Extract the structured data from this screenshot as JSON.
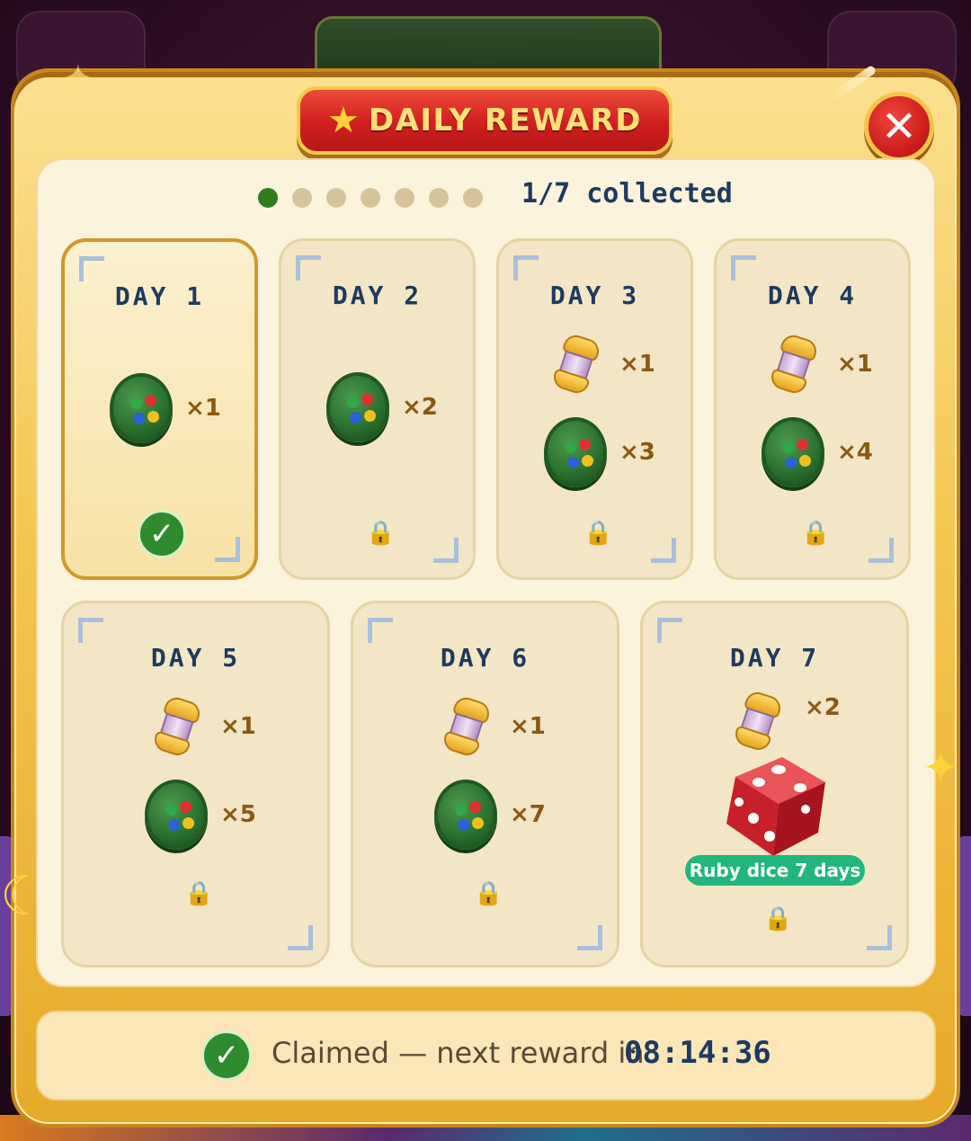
{
  "modal": {
    "title": "DAILY REWARD",
    "title_icon": "star-icon",
    "close_icon": "close-icon"
  },
  "progress": {
    "collected": 1,
    "total": 7,
    "label": "1/7 collected"
  },
  "days": [
    {
      "label": "DAY 1",
      "rewards": [
        {
          "item": "green-gem-token",
          "qty": "×1"
        }
      ],
      "status": "claimed"
    },
    {
      "label": "DAY 2",
      "rewards": [
        {
          "item": "green-gem-token",
          "qty": "×2"
        }
      ],
      "status": "locked"
    },
    {
      "label": "DAY 3",
      "rewards": [
        {
          "item": "gold-capsule",
          "qty": "×1"
        },
        {
          "item": "green-gem-token",
          "qty": "×3"
        }
      ],
      "status": "locked"
    },
    {
      "label": "DAY 4",
      "rewards": [
        {
          "item": "gold-capsule",
          "qty": "×1"
        },
        {
          "item": "green-gem-token",
          "qty": "×4"
        }
      ],
      "status": "locked"
    },
    {
      "label": "DAY 5",
      "rewards": [
        {
          "item": "gold-capsule",
          "qty": "×1"
        },
        {
          "item": "green-gem-token",
          "qty": "×5"
        }
      ],
      "status": "locked"
    },
    {
      "label": "DAY 6",
      "rewards": [
        {
          "item": "gold-capsule",
          "qty": "×1"
        },
        {
          "item": "green-gem-token",
          "qty": "×7"
        }
      ],
      "status": "locked"
    },
    {
      "label": "DAY 7",
      "rewards": [
        {
          "item": "gold-capsule",
          "qty": "×2"
        },
        {
          "item": "ruby-dice",
          "badge": "Ruby dice 7 days"
        }
      ],
      "status": "locked"
    }
  ],
  "status_bar": {
    "text": "Claimed — next reward in",
    "timer": "08:14:36"
  },
  "colors": {
    "accent_red": "#cf1f1f",
    "gold": "#f4c64e",
    "claimed_green": "#2e8b2e",
    "badge_green": "#21b67e",
    "navy_text": "#1e3a5f"
  }
}
